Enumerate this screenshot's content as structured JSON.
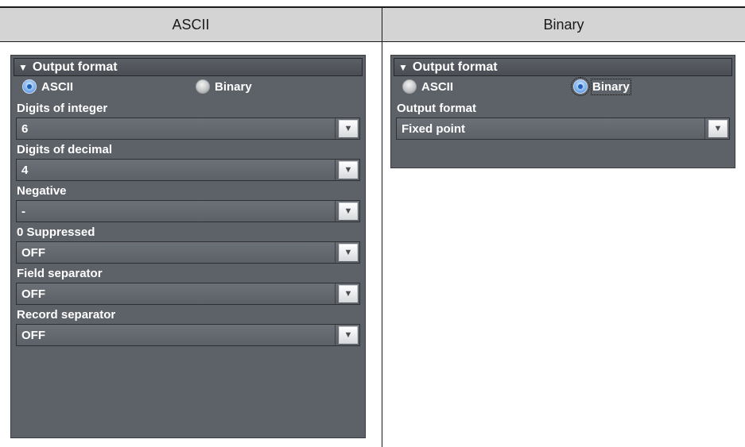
{
  "columns": [
    {
      "title": "ASCII"
    },
    {
      "title": "Binary"
    }
  ],
  "ascii_panel": {
    "title": "Output format",
    "radios": [
      {
        "label": "ASCII",
        "selected": true
      },
      {
        "label": "Binary",
        "selected": false
      }
    ],
    "fields": [
      {
        "label": "Digits of integer",
        "value": "6"
      },
      {
        "label": "Digits of decimal",
        "value": "4"
      },
      {
        "label": "Negative",
        "value": "-"
      },
      {
        "label": "0 Suppressed",
        "value": "OFF"
      },
      {
        "label": "Field separator",
        "value": "OFF"
      },
      {
        "label": "Record separator",
        "value": "OFF"
      }
    ]
  },
  "binary_panel": {
    "title": "Output format",
    "radios": [
      {
        "label": "ASCII",
        "selected": false
      },
      {
        "label": "Binary",
        "selected": true
      }
    ],
    "fields": [
      {
        "label": "Output format",
        "value": "Fixed point"
      }
    ]
  },
  "icons": {
    "collapse": "triangle-down-icon",
    "dropdown": "chevron-down-icon"
  },
  "colors": {
    "panel_bg": "#5d6168",
    "radio_selected": "#3d78c8",
    "header_bg": "#d4d4d4"
  }
}
